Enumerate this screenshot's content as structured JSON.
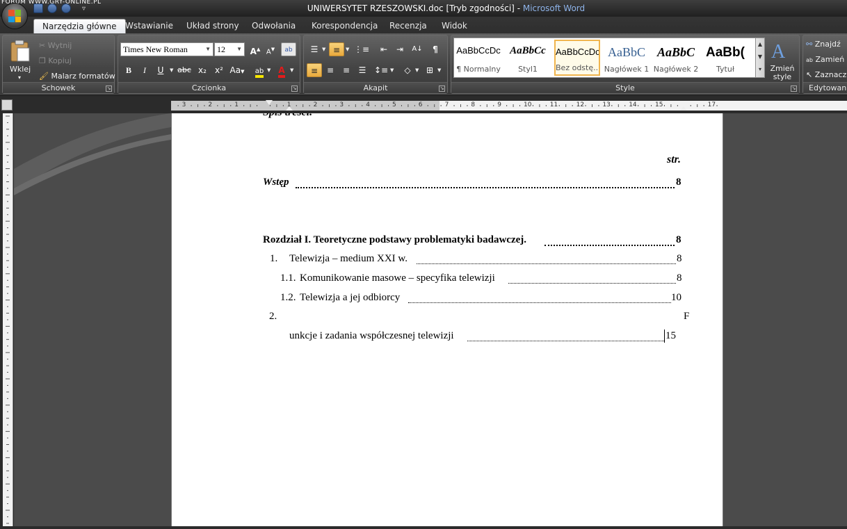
{
  "watermark": "FORUM WWW.GRY-ONLINE.PL",
  "window": {
    "title": "UNIWERSYTET RZESZOWSKI.doc [Tryb zgodności]",
    "separator": "-",
    "app": "Microsoft Word",
    "qat_more": "▿"
  },
  "tabs": [
    "Narzędzia główne",
    "Wstawianie",
    "Układ strony",
    "Odwołania",
    "Korespondencja",
    "Recenzja",
    "Widok"
  ],
  "ribbon": {
    "clipboard": {
      "label": "Schowek",
      "paste": "Wklej",
      "cut": "Wytnij",
      "copy": "Kopiuj",
      "format_painter": "Malarz formatów"
    },
    "font": {
      "label": "Czcionka",
      "font_name": "Times New Roman",
      "font_size": "12",
      "bold": "B",
      "italic": "I",
      "underline": "U",
      "strike": "abc",
      "subscript": "x₂",
      "superscript": "x²",
      "change_case": "Aa",
      "grow": "A",
      "shrink": "A"
    },
    "paragraph": {
      "label": "Akapit",
      "show_marks": "¶"
    },
    "styles": {
      "label": "Style",
      "change_styles": "Zmień style",
      "items": [
        {
          "sample": "AaBbCcDc",
          "name": "¶ Normalny"
        },
        {
          "sample": "AaBbCc",
          "name": "Styl1"
        },
        {
          "sample": "AaBbCcDc",
          "name": "Bez odstę..."
        },
        {
          "sample": "AaBbC",
          "name": "Nagłówek 1"
        },
        {
          "sample": "AaBbC",
          "name": "Nagłówek 2"
        },
        {
          "sample": "AaBb(",
          "name": "Tytuł"
        }
      ]
    },
    "editing": {
      "label": "Edytowanie",
      "find": "Znajdź",
      "replace": "Zamień",
      "select": "Zaznacz"
    }
  },
  "ruler": {
    "numbers": [
      "3",
      "2",
      "1",
      "1",
      "2",
      "3",
      "4",
      "5",
      "6",
      "7",
      "8",
      "9",
      "10",
      "11",
      "12",
      "13",
      "14",
      "15",
      "17"
    ]
  },
  "document": {
    "heading_partial": "Spis treści.",
    "page_label": "str.",
    "toc": [
      {
        "title": "Wstęp",
        "page": "8"
      },
      {
        "title": "Rozdział I. Teoretyczne podstawy problematyki badawczej.",
        "page": "8"
      },
      {
        "num": "1.",
        "title": "Telewizja – medium XXI w.",
        "page": "8"
      },
      {
        "num": "1.1.",
        "title": "Komunikowanie masowe – specyfika telewizji",
        "page": "8"
      },
      {
        "num": "1.2.",
        "title": "Telewizja a jej odbiorcy",
        "page": "10"
      },
      {
        "num": "2.",
        "title_first_letter": "F",
        "title_rest": "unkcje i zadania współczesnej telewizji",
        "page": "15"
      }
    ]
  },
  "colors": {
    "accent_title": "#8fb4ea",
    "selected_style_border": "#f0b44c",
    "pressed_button": "#e9a93c"
  }
}
